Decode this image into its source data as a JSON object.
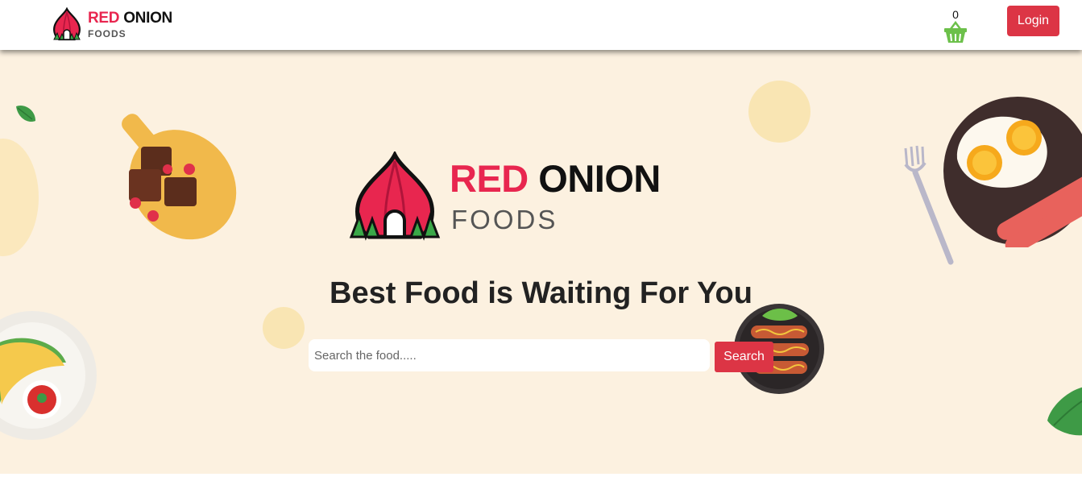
{
  "brand": {
    "name_red": "RED",
    "name_dark": "ONION",
    "subtitle": "FOODS"
  },
  "header": {
    "cart_count": "0",
    "login_label": "Login"
  },
  "hero": {
    "tagline": "Best Food is Waiting For You",
    "search_placeholder": "Search the food.....",
    "search_value": "",
    "search_button_label": "Search"
  },
  "colors": {
    "accent": "#dc3545",
    "brand_red": "#e8264f",
    "hero_bg": "#fcf1e0",
    "cart_green": "#6cc04a"
  },
  "icons": {
    "logo": "red-onion-logo-icon",
    "cart": "shopping-basket-icon"
  }
}
